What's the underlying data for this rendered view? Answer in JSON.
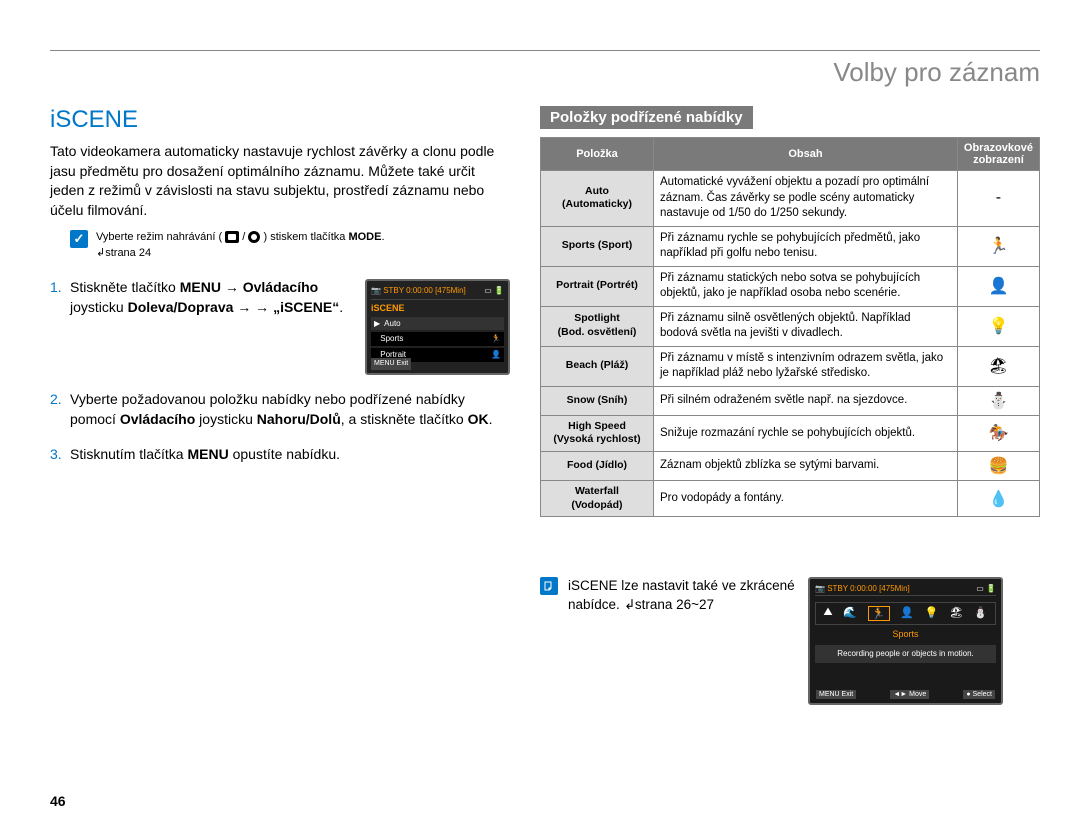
{
  "header": {
    "title": "Volby pro záznam"
  },
  "section": {
    "title": "iSCENE"
  },
  "intro": "Tato videokamera automaticky nastavuje rychlost závěrky a clonu podle jasu předmětu pro dosažení optimálního záznamu. Můžete také určit jeden z režimů v závislosti na stavu subjektu, prostředí záznamu nebo účelu filmování.",
  "precheck": {
    "prefix": "Vyberte režim nahrávání (",
    "middle": " / ",
    "suffix": ") stiskem tlačítka ",
    "mode": "MODE",
    "dot": ".",
    "pageref": "strana 24"
  },
  "steps": {
    "s1a": "Stiskněte tlačítko ",
    "s1b": "MENU",
    "s1c": " → ",
    "s1d": "Ovládacího",
    "s1e": " joysticku ",
    "s1f": "Doleva/Doprava",
    "s1g": " → „iSCENE“",
    "s1h": ".",
    "s2a": "Vyberte požadovanou položku nabídky nebo podřízené nabídky pomocí ",
    "s2b": "Ovládacího",
    "s2c": " joysticku ",
    "s2d": "Nahoru/Dolů",
    "s2e": ", a stiskněte tlačítko ",
    "s2f": "OK",
    "s2g": ".",
    "s3a": "Stisknutím tlačítka ",
    "s3b": "MENU",
    "s3c": " opustíte nabídku."
  },
  "lcd1": {
    "status": "STBY 0:00:00 [475Min]",
    "tab": "iSCENE",
    "opt1": "Auto",
    "opt2": "Sports",
    "opt3": "Portrait",
    "exit": "MENU Exit"
  },
  "subheading": "Položky podřízené nabídky",
  "table": {
    "h1": "Položka",
    "h2": "Obsah",
    "h3": "Obrazovkové zobrazení",
    "rows": [
      {
        "item": "Auto\n(Automaticky)",
        "desc": "Automatické vyvážení objektu a pozadí pro optimální záznam. Čas závěrky se podle scény automaticky nastavuje od 1/50 do 1/250 sekundy.",
        "icon": "-"
      },
      {
        "item": "Sports (Sport)",
        "desc": "Při záznamu rychle se pohybujících předmětů, jako například při golfu nebo tenisu.",
        "icon": "🏃"
      },
      {
        "item": "Portrait (Portrét)",
        "desc": "Při záznamu statických nebo sotva se pohybujících objektů, jako je například osoba nebo scenérie.",
        "icon": "👤"
      },
      {
        "item": "Spotlight\n(Bod. osvětlení)",
        "desc": "Při záznamu silně osvětlených objektů. Například bodová světla na jevišti v divadlech.",
        "icon": "💡"
      },
      {
        "item": "Beach (Pláž)",
        "desc": "Při záznamu v místě s intenzivním odrazem světla, jako je například pláž nebo lyžařské středisko.",
        "icon": "🏖"
      },
      {
        "item": "Snow (Sníh)",
        "desc": "Při silném odraženém světle např. na sjezdovce.",
        "icon": "⛄"
      },
      {
        "item": "High Speed\n(Vysoká rychlost)",
        "desc": "Snižuje rozmazání rychle se pohybujících objektů.",
        "icon": "🏇"
      },
      {
        "item": "Food (Jídlo)",
        "desc": "Záznam objektů zblízka se sytými barvami.",
        "icon": "🍔"
      },
      {
        "item": "Waterfall\n(Vodopád)",
        "desc": "Pro vodopády a fontány.",
        "icon": "💧"
      }
    ]
  },
  "tip": {
    "text": "iSCENE lze nastavit také ve zkrácené nabídce. ",
    "pageref": "strana 26~27"
  },
  "lcd2": {
    "status": "STBY 0:00:00 [475Min]",
    "label": "Sports",
    "desc": "Recording people or objects in motion.",
    "bot1": "MENU Exit",
    "bot2": "◄► Move",
    "bot3": "● Select"
  },
  "pagenum": "46"
}
